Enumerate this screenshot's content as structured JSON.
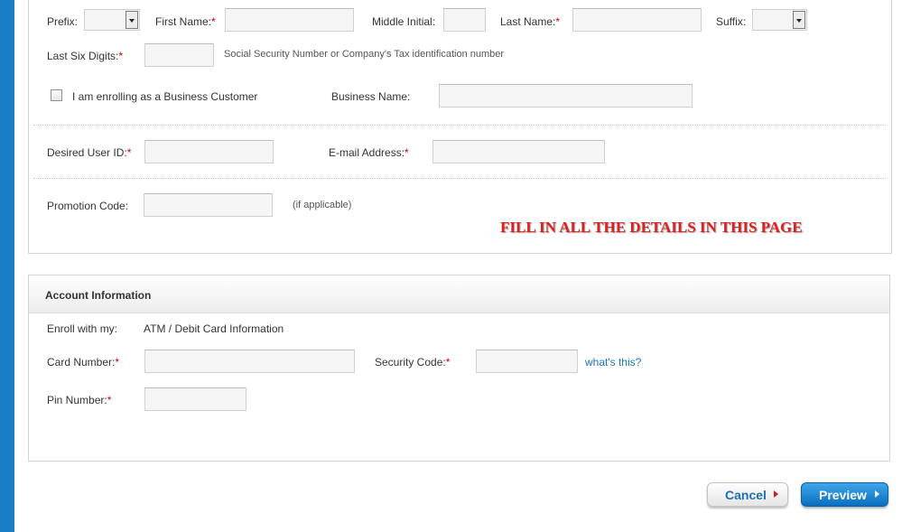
{
  "personal": {
    "prefix_label": "Prefix:",
    "first_name_label": "First Name:",
    "middle_initial_label": "Middle Initial:",
    "last_name_label": "Last Name:",
    "suffix_label": "Suffix:",
    "last_six_label": "Last Six Digits:",
    "last_six_note": "Social Security Number or Company's Tax identification number",
    "business_checkbox_label": "I am enrolling as a Business Customer",
    "business_name_label": "Business Name:",
    "user_id_label": "Desired User ID:",
    "email_label": "E-mail Address:",
    "promo_label": "Promotion Code:",
    "promo_note": "(if applicable)",
    "required_mark": "*"
  },
  "annotation": {
    "text": "FILL IN ALL THE DETAILS IN THIS PAGE",
    "color": "#e0201e"
  },
  "account": {
    "title": "Account Information",
    "enroll_label": "Enroll with my:",
    "enroll_value": "ATM / Debit Card Information",
    "card_number_label": "Card Number:",
    "security_code_label": "Security Code:",
    "whats_this_link": "what's this?",
    "pin_label": "Pin Number:"
  },
  "actions": {
    "cancel_label": "Cancel",
    "preview_label": "Preview"
  },
  "colors": {
    "accent_blue": "#1a7ec5",
    "link_blue": "#1b74c5",
    "required_red": "#cc0000"
  }
}
